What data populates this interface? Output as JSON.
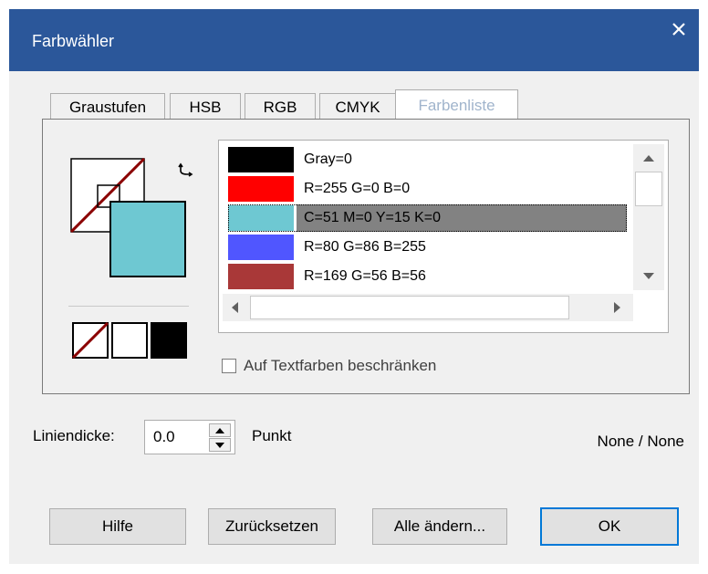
{
  "window": {
    "title": "Farbwähler"
  },
  "tabs": [
    {
      "label": "Graustufen"
    },
    {
      "label": "HSB"
    },
    {
      "label": "RGB"
    },
    {
      "label": "CMYK"
    },
    {
      "label": "Farbenliste",
      "active": true
    }
  ],
  "color_list": {
    "items": [
      {
        "label": "Gray=0",
        "color": "#000000"
      },
      {
        "label": "R=255 G=0 B=0",
        "color": "#ff0000"
      },
      {
        "label": "C=51 M=0 Y=15 K=0",
        "color": "#6ec8d2",
        "selected": true
      },
      {
        "label": "R=80 G=86 B=255",
        "color": "#5056ff"
      },
      {
        "label": "R=169 G=56 B=56",
        "color": "#a93838"
      }
    ]
  },
  "restrict_checkbox": {
    "label": "Auf Textfarben beschränken",
    "checked": false
  },
  "line_width": {
    "label": "Liniendicke:",
    "value": "0.0",
    "unit": "Punkt"
  },
  "status": "None / None",
  "buttons": {
    "help": "Hilfe",
    "reset": "Zurücksetzen",
    "change_all": "Alle ändern...",
    "ok": "OK"
  },
  "colors": {
    "titlebar": "#2b579a",
    "fill_swatch": "#6ec8d2",
    "selection": "#828282",
    "none_slash": "#8b0000"
  },
  "icons": [
    "close-icon",
    "swap-colors-icon",
    "scroll-up-icon",
    "scroll-down-icon",
    "scroll-left-icon",
    "scroll-right-icon",
    "spin-up-icon",
    "spin-down-icon"
  ]
}
